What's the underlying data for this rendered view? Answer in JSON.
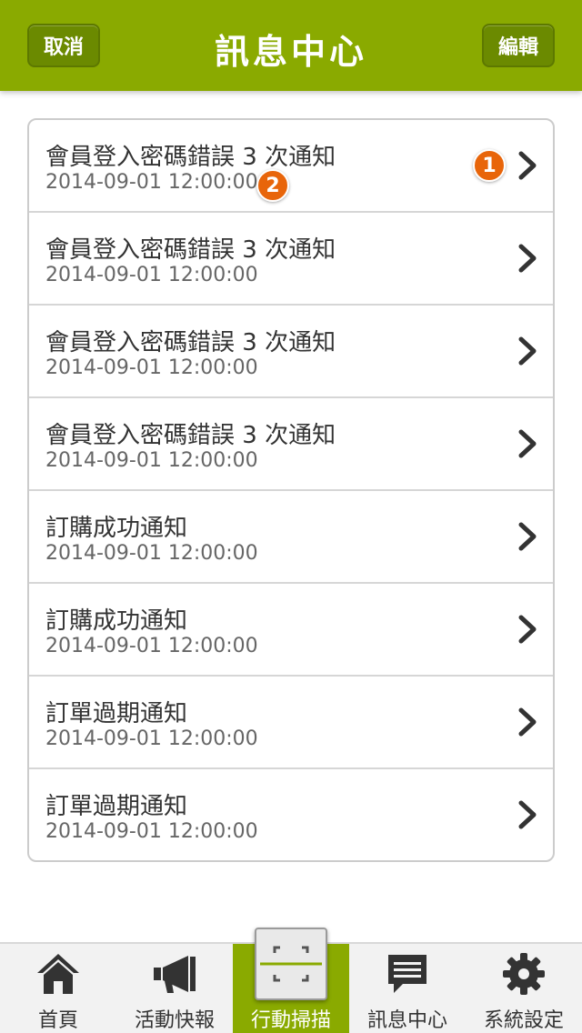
{
  "header": {
    "title": "訊息中心",
    "cancel_label": "取消",
    "edit_label": "編輯"
  },
  "messages": [
    {
      "subject": "會員登入密碼錯誤 3 次通知",
      "time": "2014-09-01 12:00:00"
    },
    {
      "subject": "會員登入密碼錯誤 3 次通知",
      "time": "2014-09-01 12:00:00"
    },
    {
      "subject": "會員登入密碼錯誤 3 次通知",
      "time": "2014-09-01 12:00:00"
    },
    {
      "subject": "會員登入密碼錯誤 3 次通知",
      "time": "2014-09-01 12:00:00"
    },
    {
      "subject": "訂購成功通知",
      "time": "2014-09-01 12:00:00"
    },
    {
      "subject": "訂購成功通知",
      "time": "2014-09-01 12:00:00"
    },
    {
      "subject": "訂單過期通知",
      "time": "2014-09-01 12:00:00"
    },
    {
      "subject": "訂單過期通知",
      "time": "2014-09-01 12:00:00"
    }
  ],
  "badges": {
    "first": "1",
    "second": "2"
  },
  "tabs": [
    {
      "label": "首頁",
      "icon": "home-icon"
    },
    {
      "label": "活動快報",
      "icon": "megaphone-icon"
    },
    {
      "label": "行動掃描",
      "icon": "scan-icon",
      "active": true
    },
    {
      "label": "訊息中心",
      "icon": "message-icon"
    },
    {
      "label": "系統設定",
      "icon": "gear-icon"
    }
  ],
  "colors": {
    "brand": "#8aaa00",
    "button": "#6b8a00",
    "badge": "#e8650a"
  }
}
